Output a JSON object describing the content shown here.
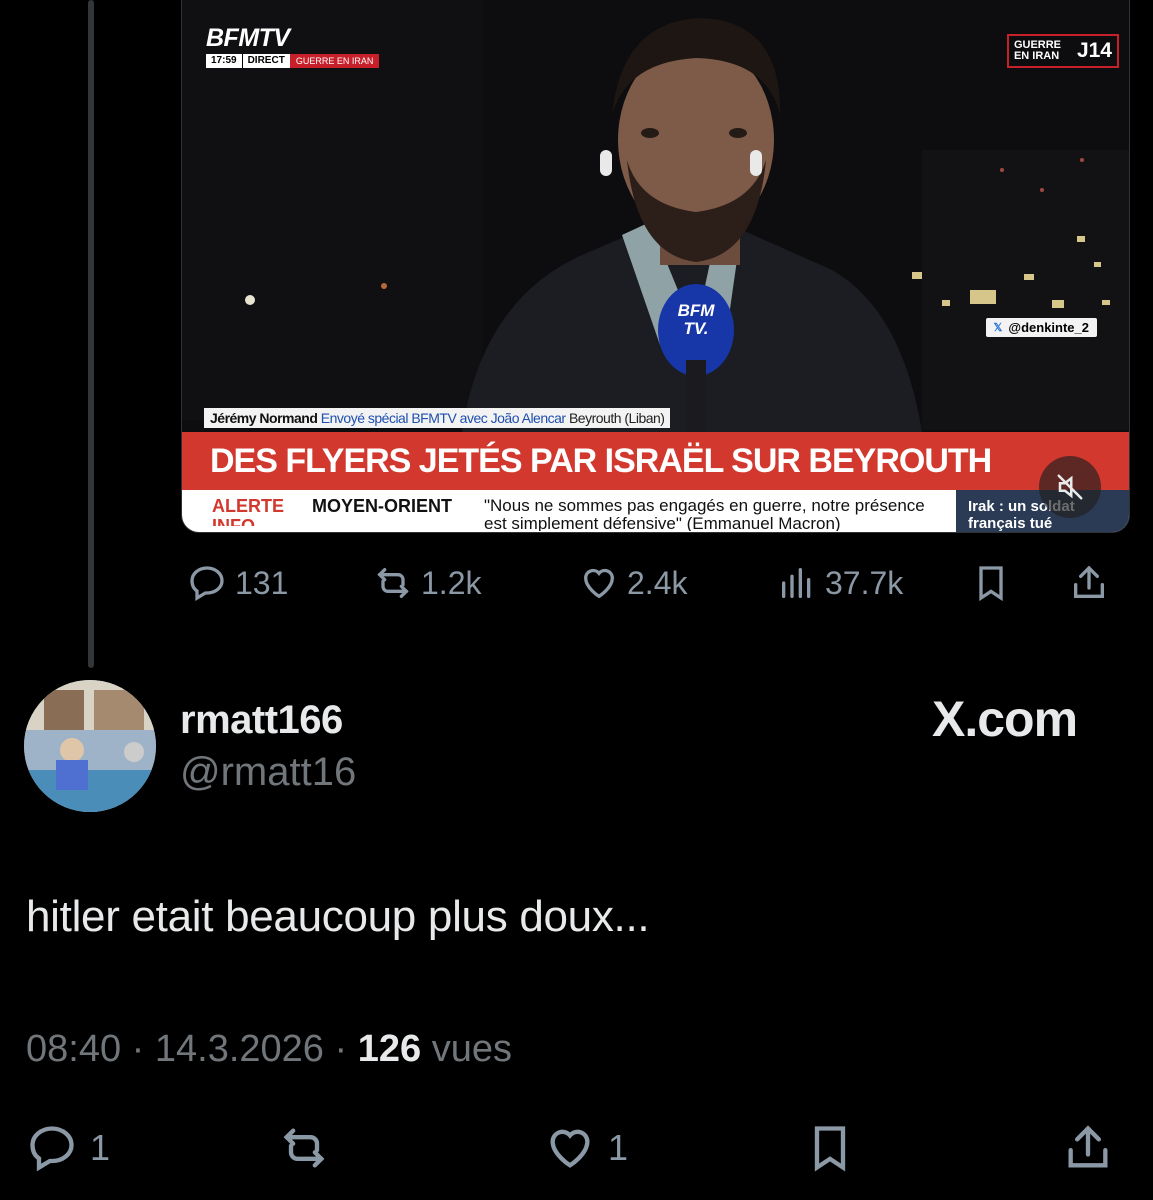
{
  "video": {
    "channel": "BFMTV",
    "time": "17:59",
    "live_label": "DIRECT",
    "topic_tag": "GUERRE EN IRAN",
    "day_badge_small": "GUERRE EN IRAN",
    "day_badge_day": "J14",
    "source_handle": "@denkinte_2",
    "caption_name": "Jérémy Normand",
    "caption_role": "Envoyé spécial BFMTV avec João Alencar",
    "caption_place": "Beyrouth (Liban)",
    "mic_label": "BFM TV.",
    "headline": "DES FLYERS JETÉS PAR ISRAËL SUR BEYROUTH",
    "ticker_alert": "ALERTE INFO",
    "ticker_section": "MOYEN-ORIENT",
    "ticker_quote": "\"Nous ne sommes pas engagés en guerre, notre présence est simplement défensive\" (Emmanuel Macron)",
    "ticker_side": "Irak : un soldat français tué"
  },
  "quoted_actions": {
    "replies": "131",
    "reposts": "1.2k",
    "likes": "2.4k",
    "views": "37.7k"
  },
  "reply": {
    "display_name": "rmatt166",
    "username": "@rmatt16",
    "text": "hitler etait beaucoup plus doux...",
    "time": "08:40",
    "date": "14.3.2026",
    "views_count": "126",
    "views_label": "vues",
    "brand": "X.com",
    "reply_count": "1",
    "like_count": "1"
  },
  "colors": {
    "background": "#000000",
    "text_primary": "#e7e9ea",
    "text_secondary": "#71767b",
    "icon_gray": "#8b98a5",
    "bfm_red": "#d2382e"
  }
}
